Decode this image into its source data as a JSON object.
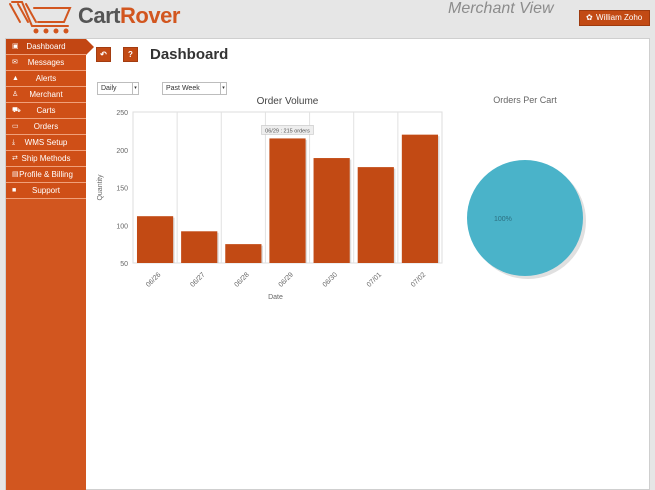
{
  "header": {
    "logo_text_a": "Cart",
    "logo_text_b": "Rover",
    "view_label": "Merchant View",
    "user_name": "William Zoho"
  },
  "sidebar": {
    "items": [
      {
        "label": "Dashboard",
        "icon": "dashboard-icon",
        "active": true
      },
      {
        "label": "Messages",
        "icon": "envelope-icon"
      },
      {
        "label": "Alerts",
        "icon": "warning-icon"
      },
      {
        "label": "Merchant",
        "icon": "user-icon"
      },
      {
        "label": "Carts",
        "icon": "cart-icon"
      },
      {
        "label": "Orders",
        "icon": "folder-icon"
      },
      {
        "label": "WMS Setup",
        "icon": "download-icon"
      },
      {
        "label": "Ship Methods",
        "icon": "exchange-icon"
      },
      {
        "label": "Profile & Billing",
        "icon": "id-card-icon"
      },
      {
        "label": "Support",
        "icon": "document-icon"
      }
    ]
  },
  "toolbar": {
    "back_icon": "undo-icon",
    "help_label": "?"
  },
  "main": {
    "title": "Dashboard",
    "interval_select": "Daily",
    "range_select": "Past Week"
  },
  "chart_data": [
    {
      "type": "bar",
      "title": "Order Volume",
      "xlabel": "Date",
      "ylabel": "Quantity",
      "categories": [
        "06/26",
        "06/27",
        "06/28",
        "06/29",
        "06/30",
        "07/01",
        "07/02"
      ],
      "values": [
        112,
        92,
        75,
        215,
        189,
        177,
        220
      ],
      "ylim": [
        50,
        250
      ],
      "yticks": [
        50,
        100,
        150,
        200,
        250
      ],
      "tooltip": "06/29 : 215 orders",
      "grid": "vertical",
      "color": "#c24a14"
    },
    {
      "type": "pie",
      "title": "Orders Per Cart",
      "slices": [
        {
          "label": "100%",
          "value": 100,
          "color": "#4ab3c9"
        }
      ]
    }
  ]
}
